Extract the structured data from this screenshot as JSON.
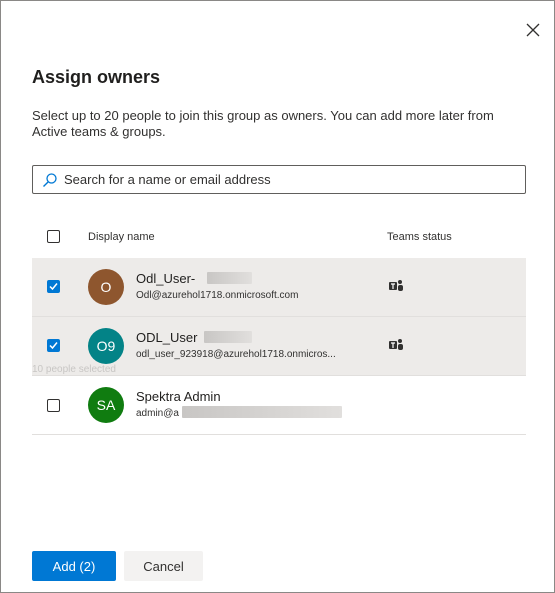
{
  "dialog": {
    "title": "Assign owners",
    "description": "Select up to 20 people to join this group as owners. You can add more later from Active teams & groups.",
    "close_icon": "close-icon"
  },
  "search": {
    "placeholder": "Search for a name or email address",
    "value": "",
    "icon": "search-icon"
  },
  "table": {
    "columns": {
      "display_name": "Display name",
      "teams_status": "Teams status"
    },
    "rows": [
      {
        "initials": "O",
        "avatar_color": "#8e562e",
        "name": "Odl_User-",
        "email": "Odl@azurehol1718.onmicrosoft.com",
        "selected": true,
        "teams_icon": "teams-icon"
      },
      {
        "initials": "O9",
        "avatar_color": "#038387",
        "name": "ODL_User",
        "email": "odl_user_923918@azurehol1718.onmicros...",
        "selected": true,
        "teams_icon": "teams-icon"
      },
      {
        "initials": "SA",
        "avatar_color": "#107c10",
        "name": "Spektra Admin",
        "email": "admin@a",
        "selected": false,
        "teams_icon": ""
      }
    ],
    "ghost_text": "10 people selected"
  },
  "footer": {
    "add_label": "Add (2)",
    "cancel_label": "Cancel"
  },
  "colors": {
    "accent": "#0078d4",
    "selected_row": "#edebe9"
  }
}
